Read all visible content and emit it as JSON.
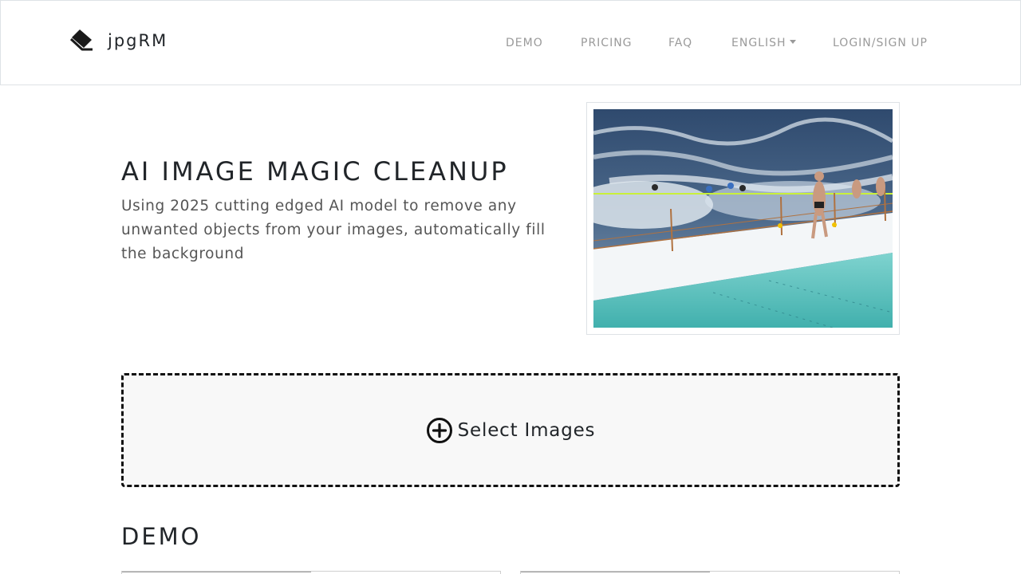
{
  "brand": {
    "name": "jpgRM",
    "icon": "eraser-icon"
  },
  "nav": {
    "items": [
      {
        "label": "DEMO"
      },
      {
        "label": "PRICING"
      },
      {
        "label": "FAQ"
      },
      {
        "label": "ENGLISH"
      },
      {
        "label": "LOGIN/SIGN UP"
      }
    ]
  },
  "hero": {
    "title": "AI IMAGE MAGIC CLEANUP",
    "subtitle": "Using 2025 cutting edged AI model to remove any unwanted objects from your images, automatically fill the background",
    "image_icon": "photo-swimmers-pool"
  },
  "upload": {
    "label": "Select Images",
    "icon": "plus-circle-icon"
  },
  "demo": {
    "title": "DEMO"
  },
  "colors": {
    "nav_text": "#9a9a9a",
    "text": "#212529",
    "subtext": "#555555",
    "border": "#dee2e6",
    "upload_bg": "#f8f8f8"
  }
}
